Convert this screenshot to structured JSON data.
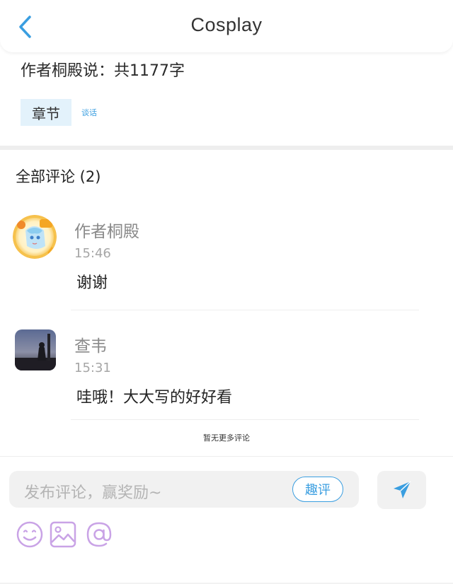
{
  "header": {
    "title": "Cosplay",
    "back_icon": "chevron-left-icon"
  },
  "chapter_info": {
    "author_says": "作者桐殿说：共1177字",
    "tag": "章节",
    "talk": "谈话"
  },
  "comments_section": {
    "title": "全部评论 (2)",
    "items": [
      {
        "name": "作者桐殿",
        "time": "15:46",
        "text": "谢谢",
        "avatar": "author-avatar"
      },
      {
        "name": "查韦",
        "time": "15:31",
        "text": "哇哦！大大写的好好看",
        "avatar": "user-avatar"
      }
    ],
    "no_more": "暂无更多评论"
  },
  "composer": {
    "placeholder": "发布评论，赢奖励~",
    "fun_review": "趣评",
    "icons": [
      "send-icon",
      "emoji-icon",
      "image-icon",
      "at-icon"
    ]
  },
  "colors": {
    "accent": "#3a9ee0",
    "tag_bg": "#e3f2fb",
    "icon_purple": "#c9a3e6"
  }
}
